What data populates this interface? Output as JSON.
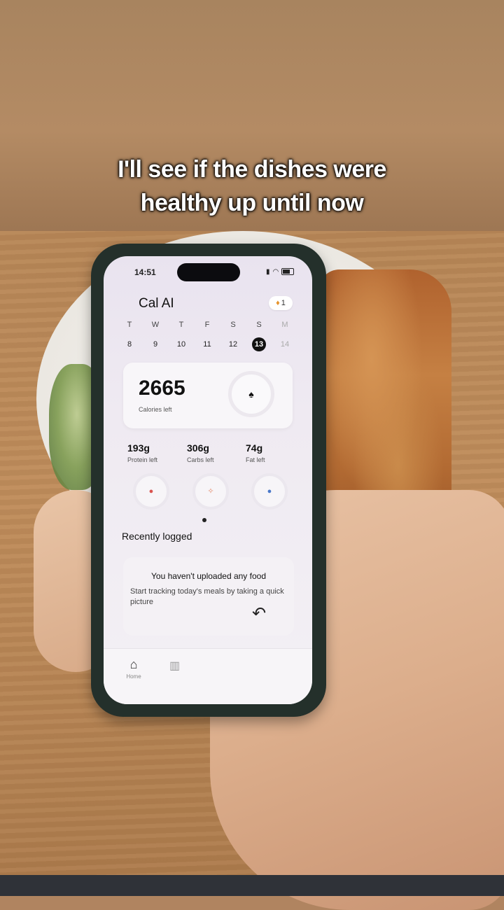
{
  "caption": {
    "line1": "I'll see if the dishes were",
    "line2": "healthy up until now"
  },
  "status_bar": {
    "time": "14:51"
  },
  "app": {
    "title": "Cal AI",
    "logo_icon": "apple-icon",
    "streak_count": "1",
    "streak_icon": "flame-icon"
  },
  "week": [
    {
      "letter": "T",
      "date": "8"
    },
    {
      "letter": "W",
      "date": "9"
    },
    {
      "letter": "T",
      "date": "10"
    },
    {
      "letter": "F",
      "date": "11"
    },
    {
      "letter": "S",
      "date": "12"
    },
    {
      "letter": "S",
      "date": "13",
      "selected": true
    },
    {
      "letter": "M",
      "date": "14",
      "future": true
    }
  ],
  "calories": {
    "value": "2665",
    "label": "Calories left",
    "icon": "flame-icon"
  },
  "macros": [
    {
      "value": "193g",
      "label": "Protein left",
      "icon": "drumstick-icon",
      "color": "#d9534f"
    },
    {
      "value": "306g",
      "label": "Carbs left",
      "icon": "wheat-icon",
      "color": "#e38a6a"
    },
    {
      "value": "74g",
      "label": "Fat left",
      "icon": "drop-icon",
      "color": "#4a78c9"
    }
  ],
  "recent": {
    "title": "Recently logged",
    "empty_title": "You haven't uploaded any food",
    "empty_text": "Start tracking today's meals by taking a quick picture"
  },
  "tabbar": {
    "home_label": "Home"
  }
}
